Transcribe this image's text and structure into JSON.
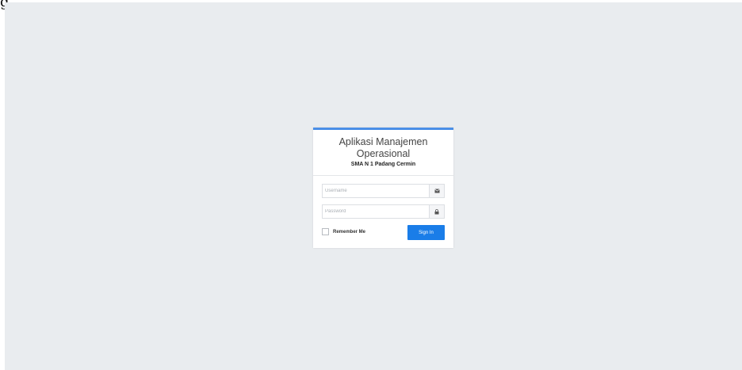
{
  "edge_glyph": "g",
  "login": {
    "title": "Aplikasi Manajemen Operasional",
    "subtitle": "SMA N 1 Padang Cermin",
    "username": {
      "placeholder": "Username",
      "value": "",
      "icon": "envelope-icon"
    },
    "password": {
      "placeholder": "Password",
      "value": "",
      "icon": "lock-icon"
    },
    "remember_label": "Remember Me",
    "remember_checked": false,
    "signin_label": "Sign In"
  },
  "colors": {
    "page_background": "#e9ecef",
    "card_top_border": "#4a8fe7",
    "primary_button": "#1a7de8"
  }
}
